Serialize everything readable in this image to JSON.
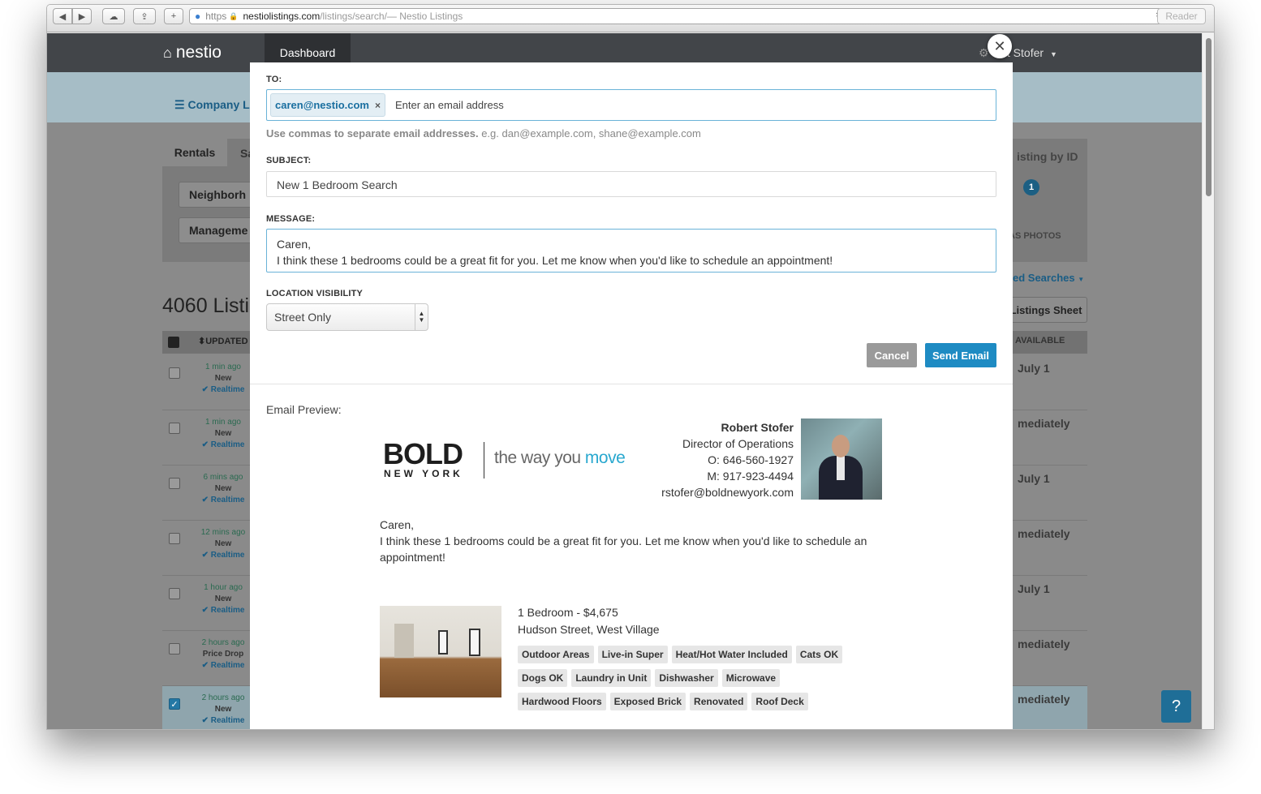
{
  "browser": {
    "url_scheme": "https",
    "url_domain": "nestiolistings.com",
    "url_path": "/listings/search/",
    "page_title_suffix": " — Nestio Listings",
    "reader_label": "Reader"
  },
  "app": {
    "logo_text": "nestio",
    "nav_dashboard": "Dashboard",
    "user_name": "ert Stofer",
    "company_link": "Company L",
    "tab_rentals": "Rentals",
    "tab_sales_partial": "Sa",
    "filter_neighborhood": "Neighborh",
    "filter_management": "Manageme",
    "listings_count": "4060 Listi",
    "col_updated": "UPDATED",
    "col_available": "AVAILABLE",
    "right_listing_by_id": "isting by ID",
    "right_badge_count": "1",
    "right_photos": "AS PHOTOS",
    "right_saved_searches": "ed Searches",
    "right_listings_sheet": "Listings Sheet",
    "help_icon": "?"
  },
  "rows": [
    {
      "time": "1 min ago",
      "status": "New",
      "tag": "Realtime",
      "available": "July 1",
      "checked": false
    },
    {
      "time": "1 min ago",
      "status": "New",
      "tag": "Realtime",
      "available": "mediately",
      "checked": false
    },
    {
      "time": "6 mins ago",
      "status": "New",
      "tag": "Realtime",
      "available": "July 1",
      "checked": false
    },
    {
      "time": "12 mins ago",
      "status": "New",
      "tag": "Realtime",
      "available": "mediately",
      "checked": false
    },
    {
      "time": "1 hour ago",
      "status": "New",
      "tag": "Realtime",
      "available": "July 1",
      "checked": false
    },
    {
      "time": "2 hours ago",
      "status": "Price Drop",
      "tag": "Realtime",
      "available": "mediately",
      "checked": false
    },
    {
      "time": "2 hours ago",
      "status": "New",
      "tag": "Realtime",
      "available": "mediately",
      "checked": true
    }
  ],
  "modal": {
    "to_label": "TO:",
    "to_chip": "caren@nestio.com",
    "to_placeholder": "Enter an email address",
    "help_bold": "Use commas to separate email addresses.",
    "help_example": " e.g. dan@example.com, shane@example.com",
    "subject_label": "SUBJECT:",
    "subject_value": "New 1 Bedroom Search",
    "message_label": "MESSAGE:",
    "message_line1": "Caren,",
    "message_line2": "I think these 1 bedrooms could be a great fit for you. Let me know when you'd like to schedule an appointment!",
    "visibility_label": "LOCATION VISIBILITY",
    "visibility_value": "Street Only",
    "cancel_label": "Cancel",
    "send_label": "Send Email",
    "preview_label": "Email Preview:"
  },
  "preview": {
    "brand_main": "BOLD",
    "brand_sub": "NEW YORK",
    "tagline_a": "the way you ",
    "tagline_b": "move",
    "agent_name": "Robert Stofer",
    "agent_title": "Director of Operations",
    "agent_office": "O: 646-560-1927",
    "agent_mobile": "M: 917-923-4494",
    "agent_email": "rstofer@boldnewyork.com",
    "greeting": "Caren,",
    "body": "I think these 1 bedrooms could be a great fit for you. Let me know when you'd like to schedule an appointment!",
    "listing_title": "1 Bedroom - $4,675",
    "listing_location": "Hudson Street, West Village",
    "amenities": [
      "Outdoor Areas",
      "Live-in Super",
      "Heat/Hot Water Included",
      "Cats OK",
      "Dogs OK",
      "Laundry in Unit",
      "Dishwasher",
      "Microwave",
      "Hardwood Floors",
      "Exposed Brick",
      "Renovated",
      "Roof Deck"
    ]
  }
}
